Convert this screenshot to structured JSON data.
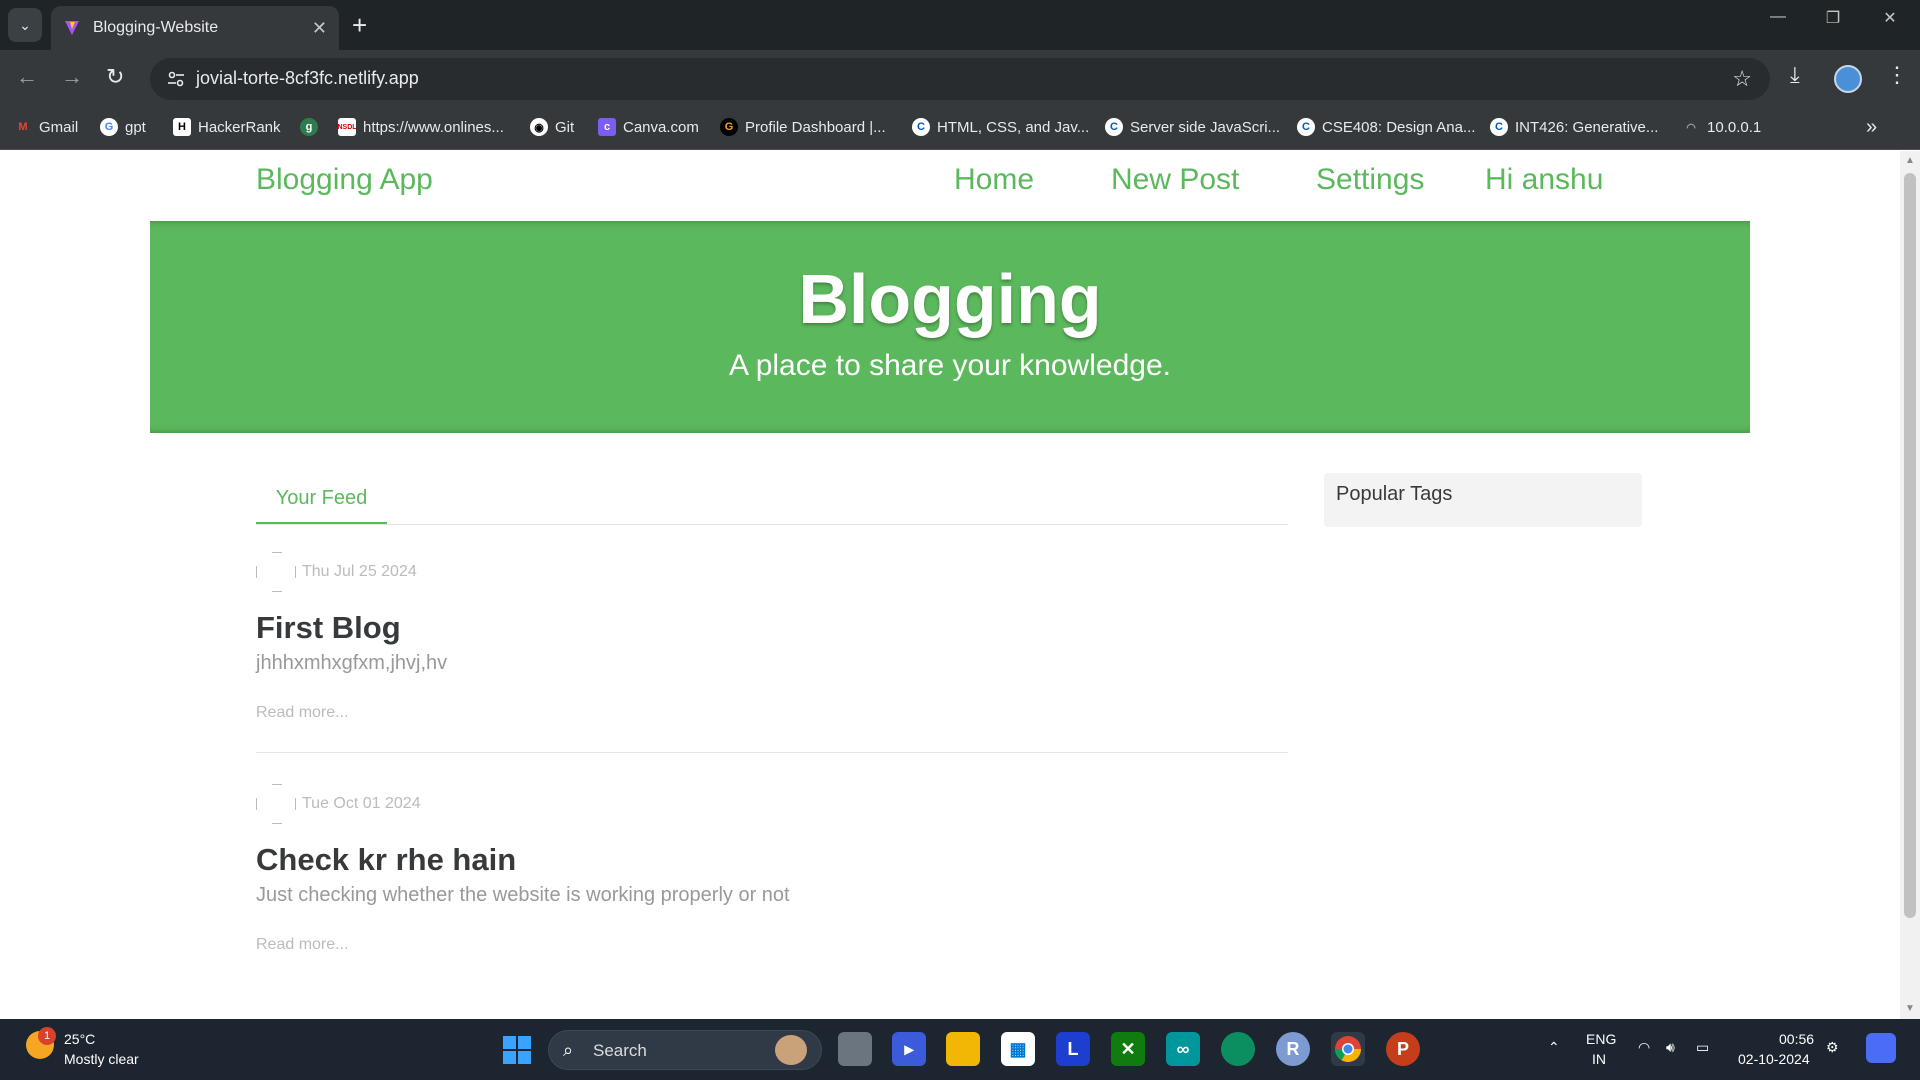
{
  "browser": {
    "tab_title": "Blogging-Website",
    "url": "jovial-torte-8cf3fc.netlify.app",
    "bookmarks": [
      {
        "label": "Gmail",
        "icon": "gmail-icon",
        "color": "#ea4335"
      },
      {
        "label": "gpt",
        "icon": "google-icon",
        "color": "#ffffff"
      },
      {
        "label": "HackerRank",
        "icon": "hackerrank-icon",
        "color": "#000000"
      },
      {
        "label": "",
        "icon": "gb-icon",
        "color": "#2f7d4f"
      },
      {
        "label": "https://www.onlines...",
        "icon": "nsdl-icon",
        "color": "#ffffff"
      },
      {
        "label": "Git",
        "icon": "github-icon",
        "color": "#ffffff"
      },
      {
        "label": "Canva.com",
        "icon": "canva-icon",
        "color": "#7b5cf5"
      },
      {
        "label": "Profile Dashboard |...",
        "icon": "profile-icon",
        "color": "#f5a623"
      },
      {
        "label": "HTML, CSS, and Jav...",
        "icon": "coursera-icon",
        "color": "#0056d2"
      },
      {
        "label": "Server side JavaScri...",
        "icon": "coursera-icon",
        "color": "#0056d2"
      },
      {
        "label": "CSE408: Design Ana...",
        "icon": "coursera-icon",
        "color": "#0056d2"
      },
      {
        "label": "INT426: Generative...",
        "icon": "coursera-icon",
        "color": "#0056d2"
      },
      {
        "label": "10.0.0.1",
        "icon": "router-icon",
        "color": "#9aa0a6"
      }
    ]
  },
  "site": {
    "brand": "Blogging App",
    "nav": [
      "Home",
      "New Post",
      "Settings",
      "Hi anshu"
    ],
    "hero_title": "Blogging",
    "hero_subtitle": "A place to share your knowledge.",
    "feed_tab": "Your Feed",
    "popular_tags_title": "Popular Tags",
    "accent_color": "#5cb85c",
    "articles": [
      {
        "date": "Thu Jul 25 2024",
        "title": "First Blog",
        "description": "jhhhxmhxgfxm,jhvj,hv",
        "read_more": "Read more..."
      },
      {
        "date": "Tue Oct 01 2024",
        "title": "Check kr rhe hain",
        "description": "Just checking whether the website is working properly or not",
        "read_more": "Read more..."
      }
    ]
  },
  "taskbar": {
    "temperature": "25°C",
    "weather": "Mostly clear",
    "weather_badge": "1",
    "search_placeholder": "Search",
    "language": "ENG",
    "region": "IN",
    "time": "00:56",
    "date": "02-10-2024"
  }
}
